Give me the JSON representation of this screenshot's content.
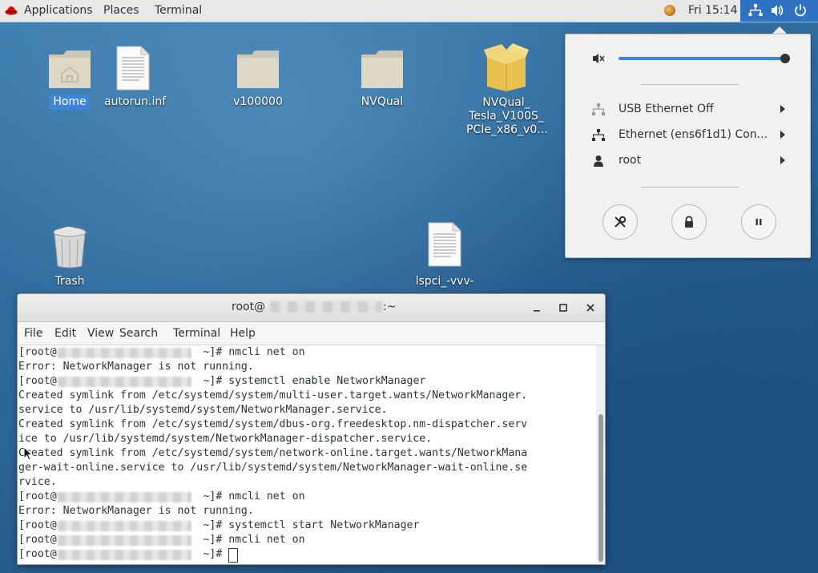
{
  "topbar": {
    "applications": "Applications",
    "places": "Places",
    "terminal": "Terminal",
    "clock": "Fri 15:14"
  },
  "desktop": {
    "icons": [
      {
        "label": "Home"
      },
      {
        "label": "autorun.inf"
      },
      {
        "label": "v100000"
      },
      {
        "label": "NVQual"
      },
      {
        "label": "NVQual_\nTesla_V100S_\nPCIe_x86_v0..."
      },
      {
        "label": "Trash"
      },
      {
        "label": "lspci_-vvv-"
      }
    ]
  },
  "system_menu": {
    "volume_level": 0.98,
    "items": [
      {
        "label": "USB Ethernet Off"
      },
      {
        "label": "Ethernet (ens6f1d1) Con..."
      },
      {
        "label": "root"
      }
    ]
  },
  "terminal": {
    "title_prefix": "root@",
    "title_suffix": ":~",
    "menu": [
      "File",
      "Edit",
      "View",
      "Search",
      "Terminal",
      "Help"
    ],
    "lines": [
      {
        "prompt": true,
        "text": "[root@",
        "after": " ~]# nmcli net on"
      },
      {
        "prompt": false,
        "text": "Error: NetworkManager is not running."
      },
      {
        "prompt": true,
        "text": "[root@",
        "after": " ~]# systemctl enable NetworkManager"
      },
      {
        "prompt": false,
        "text": "Created symlink from /etc/systemd/system/multi-user.target.wants/NetworkManager."
      },
      {
        "prompt": false,
        "text": "service to /usr/lib/systemd/system/NetworkManager.service."
      },
      {
        "prompt": false,
        "text": "Created symlink from /etc/systemd/system/dbus-org.freedesktop.nm-dispatcher.serv"
      },
      {
        "prompt": false,
        "text": "ice to /usr/lib/systemd/system/NetworkManager-dispatcher.service."
      },
      {
        "prompt": false,
        "text": "Created symlink from /etc/systemd/system/network-online.target.wants/NetworkMana"
      },
      {
        "prompt": false,
        "text": "ger-wait-online.service to /usr/lib/systemd/system/NetworkManager-wait-online.se"
      },
      {
        "prompt": false,
        "text": "rvice."
      },
      {
        "prompt": true,
        "text": "[root@",
        "after": " ~]# nmcli net on"
      },
      {
        "prompt": false,
        "text": "Error: NetworkManager is not running."
      },
      {
        "prompt": true,
        "text": "[root@",
        "after": " ~]# systemctl start NetworkManager"
      },
      {
        "prompt": true,
        "text": "[root@",
        "after": " ~]# nmcli net on"
      },
      {
        "prompt": true,
        "text": "[root@",
        "after": " ~]# "
      }
    ]
  }
}
